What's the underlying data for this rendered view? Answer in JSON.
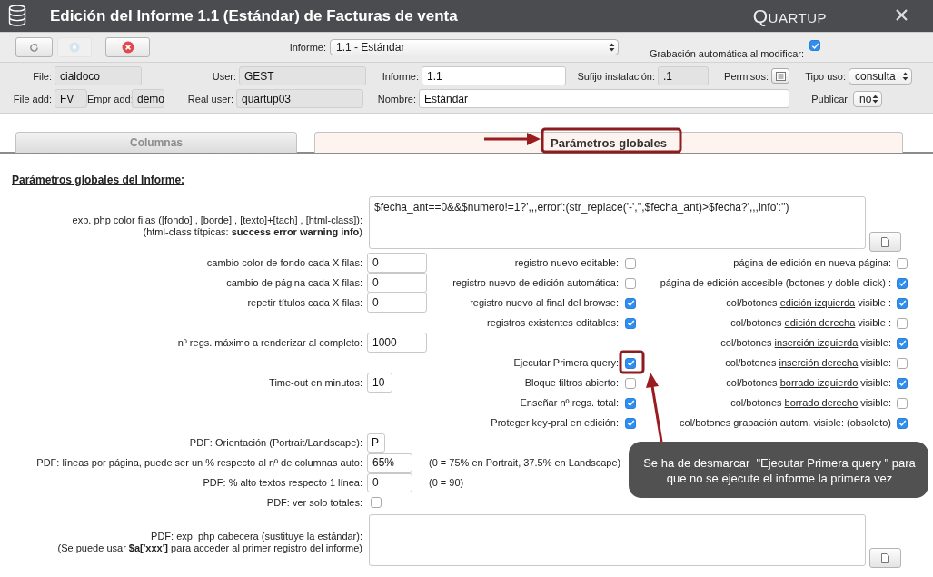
{
  "window": {
    "title": "Edición del Informe 1.1 (Estándar) de Facturas de venta",
    "brand": "QUARTUP"
  },
  "toolbar": {
    "buttons": [
      {
        "kind": "refresh",
        "disabled": false
      },
      {
        "kind": "save",
        "disabled": true
      },
      {
        "kind": "delete",
        "disabled": false
      }
    ],
    "report_label": "Informe:",
    "report_value": "1.1 - Estándar",
    "autosave_label": "Grabación automática al modificar:",
    "autosave_checked": true
  },
  "info_rows": [
    [
      {
        "label": "File:",
        "value": "cialdoco",
        "kind": "readonly"
      },
      {
        "label": "User:",
        "value": "GEST",
        "kind": "readonly"
      },
      {
        "label": "Informe:",
        "value": "1.1",
        "kind": "input"
      },
      {
        "label": "Sufijo instalación:",
        "value": ".1",
        "kind": "readonly"
      },
      {
        "label": "Permisos:",
        "kind": "button"
      },
      {
        "label": "Tipo uso:",
        "value": "consulta",
        "kind": "select"
      }
    ],
    [
      {
        "label": "File add:",
        "value": "FV",
        "kind": "readonly"
      },
      {
        "label": "Empr add:",
        "value": "demo",
        "kind": "readonly"
      },
      {
        "label": "Real user:",
        "value": "quartup03",
        "kind": "readonly"
      },
      {
        "label": "Nombre:",
        "value": "Estándar",
        "kind": "input"
      },
      {
        "label": "Publicar:",
        "value": "no",
        "kind": "select"
      }
    ]
  ],
  "tabs": [
    {
      "label": "Columnas",
      "selected": false
    },
    {
      "label": "Parámetros globales",
      "selected": true
    }
  ],
  "form": {
    "heading": "Parámetros globales del Informe:",
    "color_expr": {
      "label_lines": [
        "exp. php color filas ([fondo] , [borde] , [texto]+[tach] , [html-class]):",
        "(html-class títpicas: **success error warning info**)"
      ],
      "value": "$fecha_ant==0&&$numero!=1?',,,error':(str_replace('-','',$fecha_ant)>$fecha?',,,info':'')"
    },
    "rows": [
      {
        "left": {
          "label": "cambio color de fondo cada X filas:",
          "value": "0"
        },
        "middle": {
          "label": "registro nuevo editable:",
          "checked": false
        },
        "right": {
          "label": [
            "página de edición en nueva página:"
          ],
          "checked": false
        }
      },
      {
        "left": {
          "label": "cambio de página cada X filas:",
          "value": "0"
        },
        "middle": {
          "label": "registro nuevo de edición automática:",
          "checked": false
        },
        "right": {
          "label": [
            "página de edición accesible (botones y doble-click) :"
          ],
          "checked": true
        }
      },
      {
        "left": {
          "label": "repetir títulos cada X filas:",
          "value": "0"
        },
        "middle": {
          "label": "registro nuevo al final del browse:",
          "checked": true
        },
        "right": {
          "label": [
            "col/botones ",
            "edición izquierda",
            " visible :"
          ],
          "checked": true
        }
      },
      {
        "middle": {
          "label": "registros existentes editables:",
          "checked": true
        },
        "right": {
          "label": [
            "col/botones ",
            "edición derecha",
            " visible :"
          ],
          "checked": false
        }
      },
      {
        "left": {
          "label": "nº regs. máximo a renderizar al completo:",
          "value": "1000"
        },
        "right": {
          "label": [
            "col/botones ",
            "inserción izquierda",
            " visible:"
          ],
          "checked": true
        }
      },
      {
        "middle": {
          "label": "Ejecutar Primera query:",
          "checked": true
        },
        "right": {
          "label": [
            "col/botones ",
            "inserción derecha",
            " visible:"
          ],
          "checked": false
        }
      },
      {
        "left": {
          "label": "Time-out en minutos:",
          "value": "10"
        },
        "middle": {
          "label": "Bloque filtros abierto:",
          "checked": false
        },
        "right": {
          "label": [
            "col/botones ",
            "borrado izquierdo",
            " visible:"
          ],
          "checked": true
        }
      },
      {
        "middle": {
          "label": "Enseñar nº regs. total:",
          "checked": true
        },
        "right": {
          "label": [
            "col/botones ",
            "borrado derecho",
            " visible:"
          ],
          "checked": false
        }
      },
      {
        "middle": {
          "label": "Proteger key-pral en edición:",
          "checked": true
        },
        "right": {
          "label": [
            "col/botones grabación autom. visible: (obsoleto)"
          ],
          "checked": true
        }
      }
    ],
    "pdf_rows": [
      {
        "kind": "input",
        "label": "PDF: Orientación (Portrait/Landscape):",
        "value": "P"
      },
      {
        "kind": "input",
        "label": "PDF: líneas por página, puede ser un % respecto al nº de columnas auto:",
        "value": "65%",
        "note": "(0 = 75% en Portrait, 37.5% en Landscape)"
      },
      {
        "kind": "input",
        "label": "PDF: % alto textos respecto 1 línea:",
        "value": "0",
        "note": "(0 = 90)"
      },
      {
        "kind": "checkbox",
        "label": "PDF: ver solo totales:",
        "checked": false
      },
      {
        "kind": "textarea",
        "label_lines": [
          "PDF: exp. php cabecera (sustituye la estándar):",
          "(Se puede usar **$a['xxx']** para acceder al primer registro del informe)"
        ]
      }
    ]
  },
  "callout": {
    "text": "Se ha de desmarcar  \"Ejecutar Primera query \" para que no se ejecute el informe la primera vez"
  }
}
